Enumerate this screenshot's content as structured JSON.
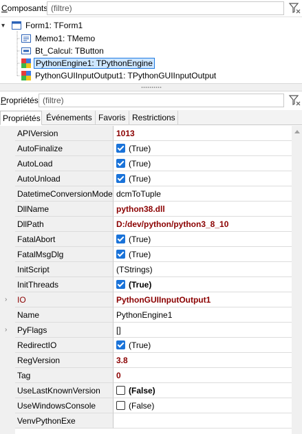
{
  "components": {
    "title_prefix": "C",
    "title_rest": "omposants",
    "filter_placeholder": "(filtre)",
    "tree": [
      {
        "label": "Form1: TForm1",
        "icon": "form-icon",
        "expand_glyph": "⌄"
      },
      {
        "label": "Memo1: TMemo",
        "icon": "memo-icon"
      },
      {
        "label": "Bt_Calcul: TButton",
        "icon": "button-component-icon"
      },
      {
        "label": "PythonEngine1: TPythonEngine",
        "icon": "python-engine-icon",
        "selected": true
      },
      {
        "label": "PythonGUIInputOutput1: TPythonGUIInputOutput",
        "icon": "python-io-icon"
      }
    ]
  },
  "properties": {
    "title_prefix": "P",
    "title_rest": "ropriétés",
    "filter_placeholder": "(filtre)",
    "tabs": [
      "Propriétés",
      "Événements",
      "Favoris",
      "Restrictions"
    ],
    "active_tab": "Propriétés",
    "rows": [
      {
        "name": "APIVersion",
        "value": "1013",
        "style": "bold"
      },
      {
        "name": "AutoFinalize",
        "value": "(True)",
        "checkbox": "on"
      },
      {
        "name": "AutoLoad",
        "value": "(True)",
        "checkbox": "on"
      },
      {
        "name": "AutoUnload",
        "value": "(True)",
        "checkbox": "on"
      },
      {
        "name": "DatetimeConversionMode",
        "value": "dcmToTuple"
      },
      {
        "name": "DllName",
        "value": "python38.dll",
        "style": "bold"
      },
      {
        "name": "DllPath",
        "value": "D:/dev/python/python3_8_10",
        "style": "bold"
      },
      {
        "name": "FatalAbort",
        "value": "(True)",
        "checkbox": "on"
      },
      {
        "name": "FatalMsgDlg",
        "value": "(True)",
        "checkbox": "on"
      },
      {
        "name": "InitScript",
        "value": "(TStrings)"
      },
      {
        "name": "InitThreads",
        "value": "(True)",
        "checkbox": "on",
        "style": "boldblack"
      },
      {
        "name": "IO",
        "value": "PythonGUIInputOutput1",
        "style": "bold",
        "linked": true,
        "expander": "›"
      },
      {
        "name": "Name",
        "value": "PythonEngine1"
      },
      {
        "name": "PyFlags",
        "value": "[]",
        "expander": "›"
      },
      {
        "name": "RedirectIO",
        "value": "(True)",
        "checkbox": "on"
      },
      {
        "name": "RegVersion",
        "value": "3.8",
        "style": "bold"
      },
      {
        "name": "Tag",
        "value": "0",
        "style": "bold"
      },
      {
        "name": "UseLastKnownVersion",
        "value": "(False)",
        "checkbox": "off",
        "style": "boldblack"
      },
      {
        "name": "UseWindowsConsole",
        "value": "(False)",
        "checkbox": "off"
      },
      {
        "name": "VenvPythonExe",
        "value": ""
      }
    ]
  },
  "colors": {
    "accent": "#1a73d9",
    "modified_value": "#8b0000",
    "selection": "#cde6ff"
  }
}
